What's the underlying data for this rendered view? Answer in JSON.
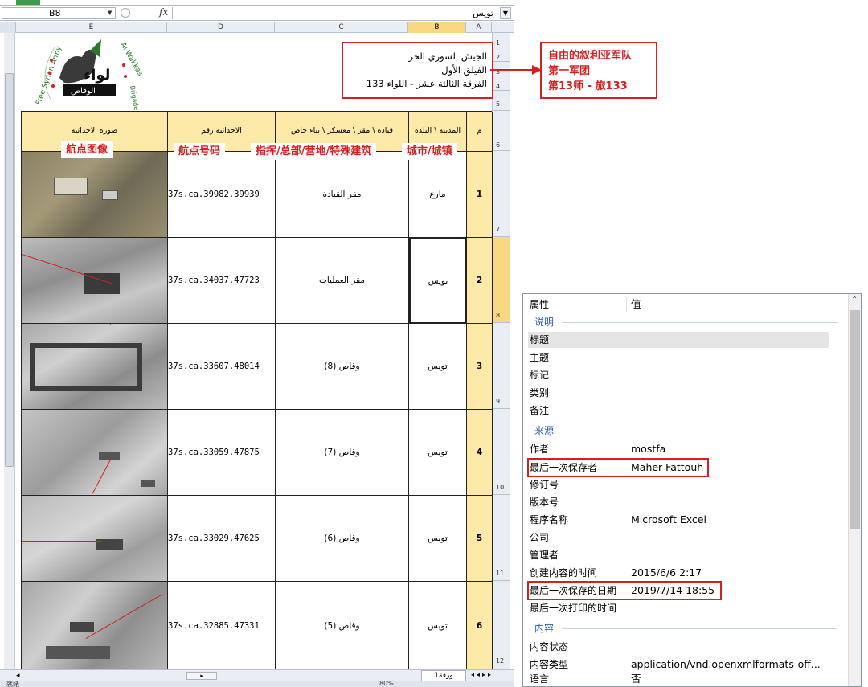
{
  "excel": {
    "name_box": "B8",
    "fx_label": "fx",
    "formula_value": "تويس",
    "columns": [
      "E",
      "D",
      "C",
      "B",
      "A"
    ],
    "rows": [
      "1",
      "2",
      "3",
      "4",
      "5",
      "6",
      "7",
      "8",
      "9",
      "10",
      "11",
      "12"
    ],
    "header_lines": [
      "الجيش السوري الحر",
      "الفيلق الأول",
      "الفرقة الثالثة عشر - اللواء 133"
    ],
    "logo_text": {
      "top_right": "Al Wakkas",
      "left": "Free Syrian Army",
      "bottom_right": "Brigade",
      "main": "لواء",
      "sub": "الوقاص"
    },
    "table_headers": {
      "photo": "صورة الاحداثية",
      "coord": "الاحداثية رقم",
      "building": "قيادة \\ مقر \\ معسكر \\ بناء خاص",
      "city": "المدينة \\ البلدة",
      "num": "م"
    },
    "cn_labels": {
      "photo": "航点图像",
      "coord": "航点号码",
      "building": "指挥/总部/营地/特殊建筑",
      "city": "城市/城镇"
    },
    "table_rows": [
      {
        "num": "1",
        "city": "مارع",
        "building": "مقر القيادة",
        "coord": "37s.ca.39982.39939"
      },
      {
        "num": "2",
        "city": "تويس",
        "building": "مقر العمليات",
        "coord": "37s.ca.34037.47723"
      },
      {
        "num": "3",
        "city": "تويس",
        "building": "وقاص (8)",
        "coord": "37s.ca.33607.48014"
      },
      {
        "num": "4",
        "city": "تويس",
        "building": "وقاص (7)",
        "coord": "37s.ca.33059.47875"
      },
      {
        "num": "5",
        "city": "تويس",
        "building": "وقاص (6)",
        "coord": "37s.ca.33029.47625"
      },
      {
        "num": "6",
        "city": "تويس",
        "building": "وقاص (5)",
        "coord": "37s.ca.32885.47331"
      }
    ],
    "sheet_tab": "ورقة1",
    "zoom": "80%",
    "status": "就绪"
  },
  "callout": {
    "lines": [
      "自由的叙利亚军队",
      "第一军团",
      "第13师 - 旅133"
    ]
  },
  "properties": {
    "col_name": "属性",
    "col_value": "值",
    "sections": [
      {
        "title": "说明",
        "items": [
          {
            "name": "标题",
            "value": ""
          },
          {
            "name": "主题",
            "value": ""
          },
          {
            "name": "标记",
            "value": ""
          },
          {
            "name": "类别",
            "value": ""
          },
          {
            "name": "备注",
            "value": ""
          }
        ]
      },
      {
        "title": "来源",
        "items": [
          {
            "name": "作者",
            "value": "mostfa"
          },
          {
            "name": "最后一次保存者",
            "value": "Maher Fattouh"
          },
          {
            "name": "修订号",
            "value": ""
          },
          {
            "name": "版本号",
            "value": ""
          },
          {
            "name": "程序名称",
            "value": "Microsoft Excel"
          },
          {
            "name": "公司",
            "value": ""
          },
          {
            "name": "管理者",
            "value": ""
          },
          {
            "name": "创建内容的时间",
            "value": "2015/6/6 2:17"
          },
          {
            "name": "最后一次保存的日期",
            "value": "2019/7/14 18:55"
          },
          {
            "name": "最后一次打印的时间",
            "value": ""
          }
        ]
      },
      {
        "title": "内容",
        "items": [
          {
            "name": "内容状态",
            "value": ""
          },
          {
            "name": "内容类型",
            "value": "application/vnd.openxmlformats-off..."
          },
          {
            "name": "语言",
            "value": "否"
          }
        ]
      }
    ]
  }
}
